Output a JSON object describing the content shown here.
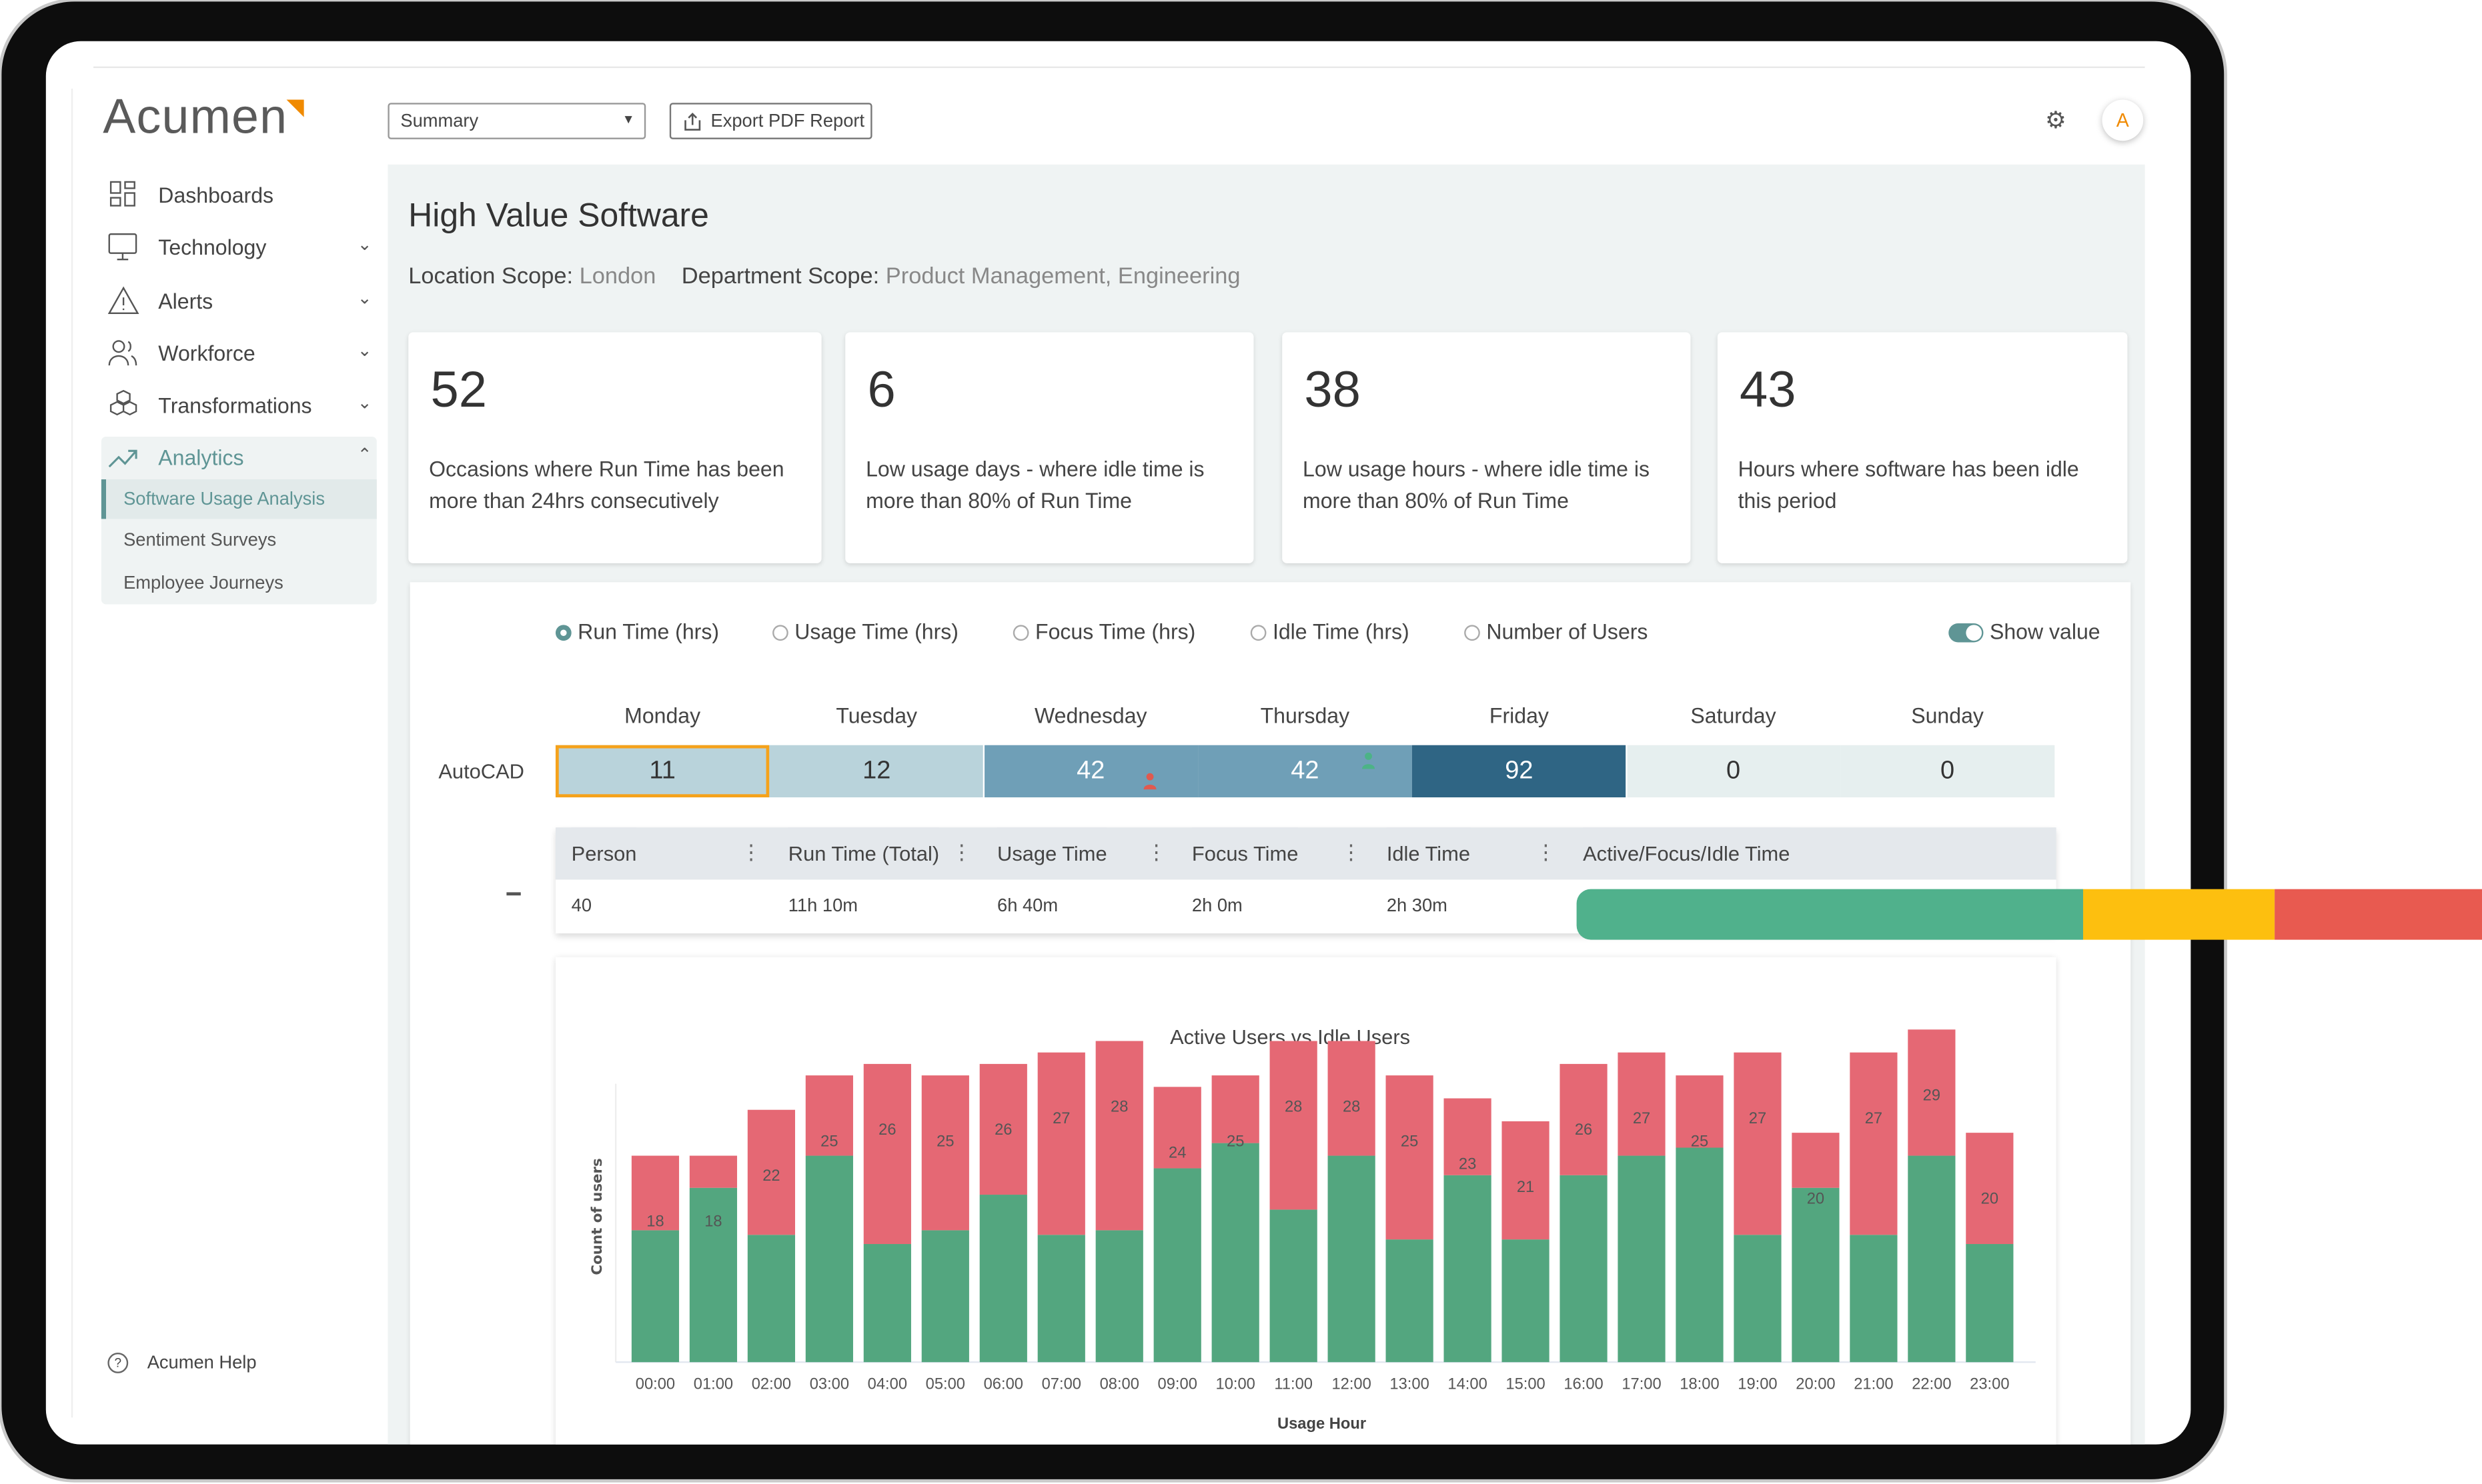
{
  "app": {
    "logo_text": "Acumen",
    "brand_color": "#f08a00",
    "accent_color": "#5f9595"
  },
  "sidebar": {
    "items": [
      {
        "label": "Dashboards",
        "icon": "dashboard-grid-icon",
        "chevron": ""
      },
      {
        "label": "Technology",
        "icon": "monitor-icon",
        "chevron": "v"
      },
      {
        "label": "Alerts",
        "icon": "warning-triangle-icon",
        "chevron": "v"
      },
      {
        "label": "Workforce",
        "icon": "users-icon",
        "chevron": "v"
      },
      {
        "label": "Transformations",
        "icon": "cubes-icon",
        "chevron": "v"
      },
      {
        "label": "Analytics",
        "icon": "trending-up-icon",
        "chevron": "^"
      }
    ],
    "sub_items": [
      "Software Usage Analysis",
      "Sentiment Surveys",
      "Employee Journeys"
    ],
    "active_sub_item": "Software Usage Analysis",
    "help_label": "Acumen Help"
  },
  "toolbar": {
    "view_select": "Summary",
    "export_label": "Export PDF Report",
    "avatar_initial": "A"
  },
  "page": {
    "title": "High Value Software",
    "location_label": "Location Scope:",
    "location_value": "London",
    "department_label": "Department Scope:",
    "department_value": "Product Management, Engineering"
  },
  "cards": [
    {
      "value": "52",
      "text": "Occasions where Run Time has been more than 24hrs consecutively"
    },
    {
      "value": "6",
      "text": "Low usage days - where idle time is more than 80% of Run Time"
    },
    {
      "value": "38",
      "text": "Low usage hours - where idle time is more than 80% of Run Time"
    },
    {
      "value": "43",
      "text": "Hours where software has been idle this period"
    }
  ],
  "metric_options": [
    "Run Time (hrs)",
    "Usage Time (hrs)",
    "Focus Time (hrs)",
    "Idle Time (hrs)",
    "Number of Users"
  ],
  "selected_metric": "Run Time (hrs)",
  "show_value": {
    "label": "Show value",
    "on": true
  },
  "heatmap": {
    "row_label": "AutoCAD",
    "days": [
      "Monday",
      "Tuesday",
      "Wednesday",
      "Thursday",
      "Friday",
      "Saturday",
      "Sunday"
    ],
    "values": [
      "11",
      "12",
      "42",
      "42",
      "92",
      "0",
      "0"
    ],
    "colors": [
      "#b9d3db",
      "#b9d3db",
      "#6f9fb7",
      "#6f9fb7",
      "#2f6584",
      "#e6efef",
      "#e6efef"
    ],
    "selected_day": "Monday",
    "markers": {
      "Wednesday": "#e05a4f",
      "Thursday": "#4cb386"
    }
  },
  "table": {
    "headers": [
      "Person",
      "Run Time (Total)",
      "Usage Time",
      "Focus Time",
      "Idle Time",
      "Active/Focus/Idle Time"
    ],
    "row": [
      "40",
      "11h 10m",
      "6h 40m",
      "2h 0m",
      "2h 30m"
    ],
    "activity_bar": [
      {
        "segment": "active",
        "fraction": 0.559,
        "color": "#50b18c"
      },
      {
        "segment": "focus",
        "fraction": 0.212,
        "color": "#fdbf0f"
      },
      {
        "segment": "idle",
        "fraction": 0.229,
        "color": "#e85a50"
      }
    ]
  },
  "chart_data": {
    "type": "bar",
    "stacked": true,
    "title": "Active Users vs Idle Users",
    "xlabel": "Usage Hour",
    "ylabel": "Count of users",
    "ylim": [
      7,
      29
    ],
    "grid": false,
    "categories": [
      "00:00",
      "01:00",
      "02:00",
      "03:00",
      "04:00",
      "05:00",
      "06:00",
      "07:00",
      "08:00",
      "09:00",
      "10:00",
      "11:00",
      "12:00",
      "13:00",
      "14:00",
      "15:00",
      "16:00",
      "17:00",
      "18:00",
      "19:00",
      "20:00",
      "21:00",
      "22:00",
      "23:00"
    ],
    "series": [
      {
        "color": "#53a67f",
        "values": [
          11.5,
          15.2,
          11.1,
          18,
          10.3,
          11.5,
          14.6,
          11.1,
          11.5,
          16.9,
          19.1,
          13.3,
          18,
          10.7,
          16.3,
          10.7,
          16.3,
          18,
          18.7,
          11.1,
          15.2,
          11.1,
          18,
          10.3
        ]
      },
      {
        "color": "#e56874",
        "values": [
          6.5,
          2.8,
          10.9,
          7,
          15.7,
          13.5,
          11.4,
          15.9,
          16.5,
          7.1,
          5.9,
          14.7,
          10,
          14.3,
          6.7,
          10.3,
          9.7,
          9,
          6.3,
          15.9,
          4.8,
          15.9,
          11,
          9.7
        ]
      }
    ],
    "totals": [
      18,
      18,
      22,
      25,
      26,
      25,
      26,
      27,
      28,
      24,
      25,
      28,
      28,
      25,
      23,
      21,
      26,
      27,
      25,
      27,
      20,
      27,
      29,
      20
    ]
  }
}
